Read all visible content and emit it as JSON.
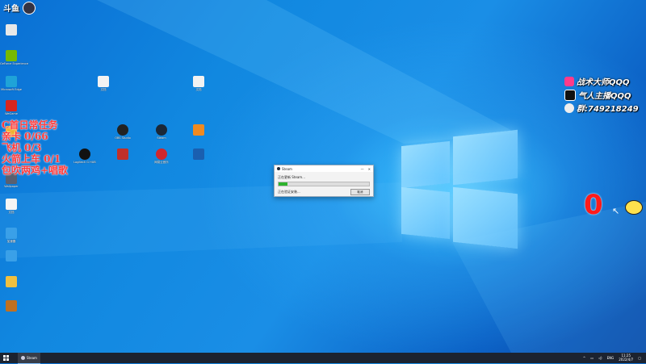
{
  "desktop": {
    "icons_left": [
      {
        "label": "",
        "color": "#e8e8e8",
        "icon": "recycle-bin-icon"
      },
      {
        "label": "GeForce Experience",
        "color": "#76b900",
        "icon": "nvidia-icon"
      },
      {
        "label": "Microsoft Edge",
        "color": "#1fa3d8",
        "icon": "edge-icon"
      },
      {
        "label": "WeGame",
        "color": "#d7261e",
        "icon": "game-icon"
      },
      {
        "label": "",
        "color": "#f0b030",
        "icon": "app-icon"
      },
      {
        "label": "Wallpaper",
        "color": "#5a6070",
        "icon": "app-icon"
      },
      {
        "label": "文档",
        "color": "#f5f5f5",
        "icon": "document-icon"
      },
      {
        "label": "加速器",
        "color": "#3aa0e8",
        "icon": "app-icon"
      },
      {
        "label": "",
        "color": "#3aa0e8",
        "icon": "app-icon"
      },
      {
        "label": "",
        "color": "#f0c040",
        "icon": "folder-icon"
      },
      {
        "label": "",
        "color": "#c07020",
        "icon": "game-icon"
      }
    ],
    "icons_grid": [
      {
        "label": "文档",
        "color": "#f2f2f2",
        "icon": "document-icon"
      },
      {
        "label": "文档",
        "color": "#f2f2f2",
        "icon": "document-icon"
      },
      {
        "label": "OBS Studio",
        "color": "#222222",
        "icon": "obs-icon"
      },
      {
        "label": "Steam",
        "color": "#1b2838",
        "icon": "steam-icon"
      },
      {
        "label": "",
        "color": "#f08a20",
        "icon": "app-icon"
      },
      {
        "label": "Logitech G HUB",
        "color": "#111111",
        "icon": "logitech-icon"
      },
      {
        "label": "",
        "color": "#c0302a",
        "icon": "app-icon"
      },
      {
        "label": "网易云音乐",
        "color": "#d0272d",
        "icon": "music-icon"
      },
      {
        "label": "",
        "color": "#1a5fb0",
        "icon": "app-icon"
      }
    ]
  },
  "overlay": {
    "title": "C首日常任务",
    "lines": [
      "亲卡 0/66",
      "飞机 0/3",
      "火箭上车 0/1",
      "包吹两鸡+唱歌"
    ]
  },
  "social": [
    {
      "text": "战术大师QQQ",
      "color": "#ff3b8a",
      "icon": "live-app-icon"
    },
    {
      "text": "气人主播QQQ",
      "color": "#111111",
      "icon": "tiktok-icon"
    },
    {
      "text": "群:749218249",
      "color": "#e0e0e0",
      "icon": "qq-icon"
    }
  ],
  "counter": {
    "value": "0",
    "color": "#ff1a1a"
  },
  "dialog": {
    "title": "Steam",
    "line1": "正在更新 Steam...",
    "line2": "正在验证安装...",
    "button": "取消",
    "progress": 0.1
  },
  "taskbar": {
    "app_label": "Steam",
    "tray": "ENG",
    "time": "11:25",
    "date": "2022/4/7"
  },
  "colors": {
    "accent": "#0078d7",
    "taskbar": "#1c2330"
  }
}
